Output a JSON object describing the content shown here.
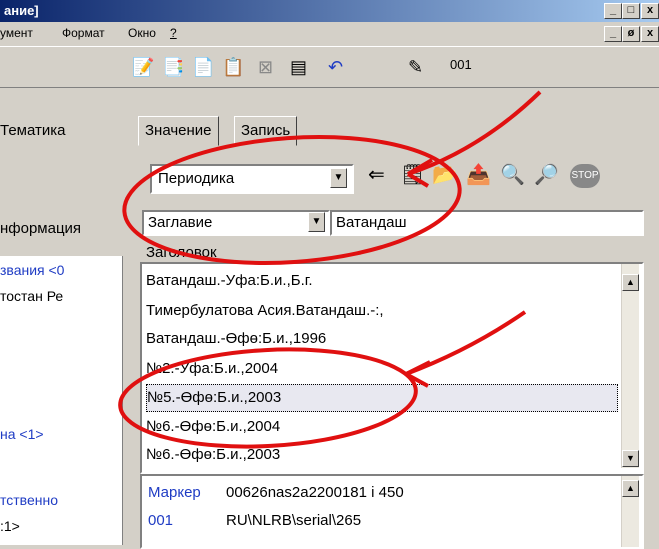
{
  "titlebar": {
    "title": "ание]",
    "min": "_",
    "max": "□",
    "close": "x"
  },
  "menubar": {
    "items": [
      "умент",
      "Формат",
      "Окно",
      "?"
    ],
    "min2": "_",
    "restore2": "ø",
    "close2": "x"
  },
  "toolbar": {
    "label": "001"
  },
  "left": {
    "tab_thematics": "Тематика",
    "tab_info": "нформация",
    "lines": [
      "звания  <0",
      "тостан Ре",
      "на  <1>",
      "тственно",
      ":1>"
    ]
  },
  "tabs": {
    "value": "Значение",
    "record": "Запись"
  },
  "database_select": {
    "value": "Периодика"
  },
  "search": {
    "field": "Заглавие",
    "term": "Ватандаш"
  },
  "header_label": "Заголовок",
  "results": [
    "Ватандаш.-Уфа:Б.и.,Б.г.",
    "Тимербулатова Асия.Ватандаш.-:,",
    "Ватандаш.-Өфө:Б.и.,1996",
    "№2.-Уфа:Б.и.,2004",
    "№5.-Өфө:Б.и.,2003",
    "№6.-Өфө:Б.и.,2004",
    "№6.-Өфө:Б.и.,2003"
  ],
  "selected_index": 4,
  "marc": [
    {
      "tag": "Маркер",
      "value": "00626nas2a2200181 i 450"
    },
    {
      "tag": "001",
      "value": "RU\\NLRB\\serial\\265"
    }
  ],
  "icons": {
    "toolbar": [
      "edit-doc-icon",
      "copy-doc-icon",
      "new-doc-icon",
      "copy-docs-icon",
      "delete-doc-icon",
      "form-icon",
      "undo-icon",
      "stamp-icon"
    ],
    "search_toolbar": [
      "import-icon",
      "export-icon",
      "folder-icon",
      "transfer-icon",
      "search-binoculars-icon",
      "help-search-icon",
      "stop-icon"
    ]
  },
  "colors": {
    "link": "#1f3cc4",
    "annotation": "#e01010",
    "title_bar": "#0a246a"
  }
}
